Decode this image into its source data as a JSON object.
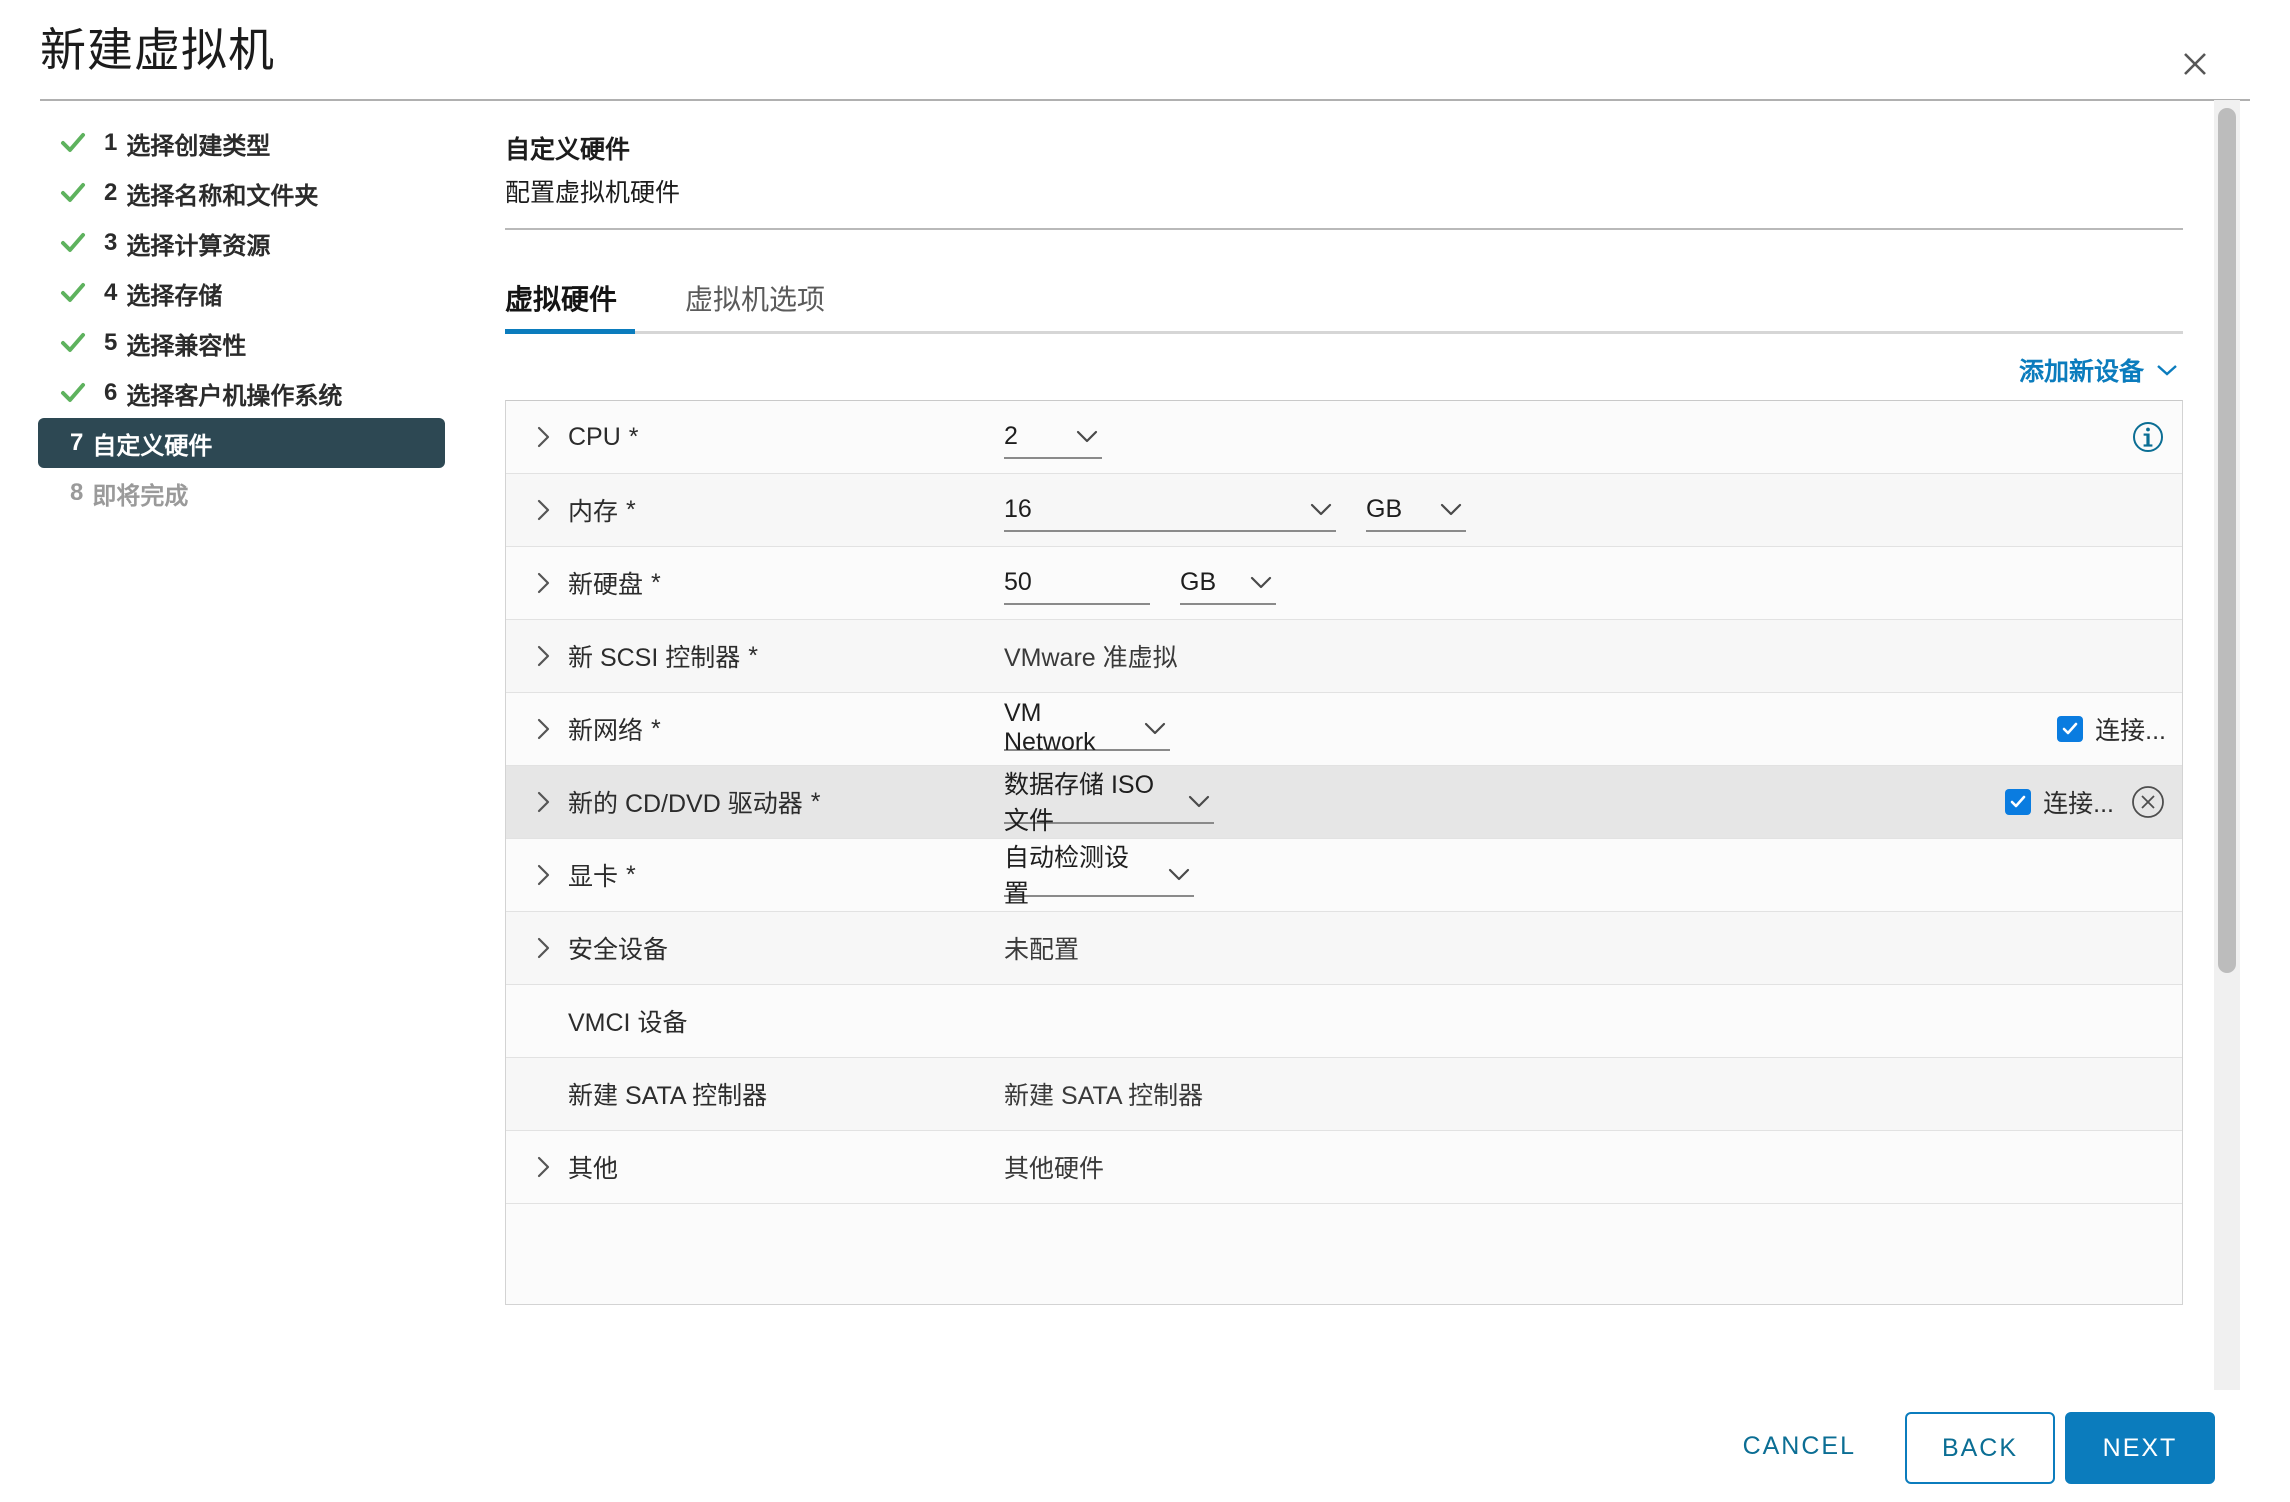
{
  "window": {
    "title": "新建虚拟机",
    "close_icon": "close-icon"
  },
  "sidebar": {
    "steps": [
      {
        "num": "1",
        "label": "选择创建类型",
        "state": "done"
      },
      {
        "num": "2",
        "label": "选择名称和文件夹",
        "state": "done"
      },
      {
        "num": "3",
        "label": "选择计算资源",
        "state": "done"
      },
      {
        "num": "4",
        "label": "选择存储",
        "state": "done"
      },
      {
        "num": "5",
        "label": "选择兼容性",
        "state": "done"
      },
      {
        "num": "6",
        "label": "选择客户机操作系统",
        "state": "done"
      },
      {
        "num": "7",
        "label": "自定义硬件",
        "state": "active"
      },
      {
        "num": "8",
        "label": "即将完成",
        "state": "upcoming"
      }
    ]
  },
  "main": {
    "heading": "自定义硬件",
    "subheading": "配置虚拟机硬件",
    "tabs": [
      {
        "label": "虚拟硬件",
        "active": true
      },
      {
        "label": "虚拟机选项",
        "active": false
      }
    ],
    "add_device_label": "添加新设备",
    "add_device_icon": "chevron-down-icon"
  },
  "hardware": {
    "rows": [
      {
        "label": "CPU",
        "required": "*",
        "value": "2",
        "control": "select",
        "info_icon": "info-icon"
      },
      {
        "label": "内存",
        "required": "*",
        "value": "16",
        "unit": "GB",
        "control": "select-with-unit"
      },
      {
        "label": "新硬盘",
        "required": "*",
        "value": "50",
        "unit": "GB",
        "control": "input-with-unit"
      },
      {
        "label": "新 SCSI 控制器",
        "required": "*",
        "value": "VMware 准虚拟",
        "control": "text"
      },
      {
        "label": "新网络",
        "required": "*",
        "value": "VM Network",
        "control": "select",
        "checkbox_label": "连接...",
        "checkbox_checked": true
      },
      {
        "label": "新的 CD/DVD 驱动器",
        "required": "*",
        "value": "数据存储 ISO 文件",
        "control": "select",
        "checkbox_label": "连接...",
        "checkbox_checked": true,
        "remove_icon": "remove-circle-icon",
        "selected": true
      },
      {
        "label": "显卡",
        "required": "*",
        "value": "自动检测设置",
        "control": "select"
      },
      {
        "label": "安全设备",
        "required": "",
        "value": "未配置",
        "control": "text"
      },
      {
        "label": "VMCI 设备",
        "required": "",
        "value": "",
        "control": "none",
        "no_caret": true
      },
      {
        "label": "新建 SATA 控制器",
        "required": "",
        "value": "新建 SATA 控制器",
        "control": "text",
        "no_caret": true
      },
      {
        "label": "其他",
        "required": "",
        "value": "其他硬件",
        "control": "text"
      }
    ]
  },
  "footer": {
    "cancel_label": "CANCEL",
    "back_label": "BACK",
    "next_label": "NEXT"
  },
  "colors": {
    "accent_blue": "#0b7cbd",
    "link_blue": "#0b6e94",
    "active_step_bg": "#2d4853",
    "check_green": "#5eb25e",
    "checkbox_blue": "#0a7ce0"
  }
}
